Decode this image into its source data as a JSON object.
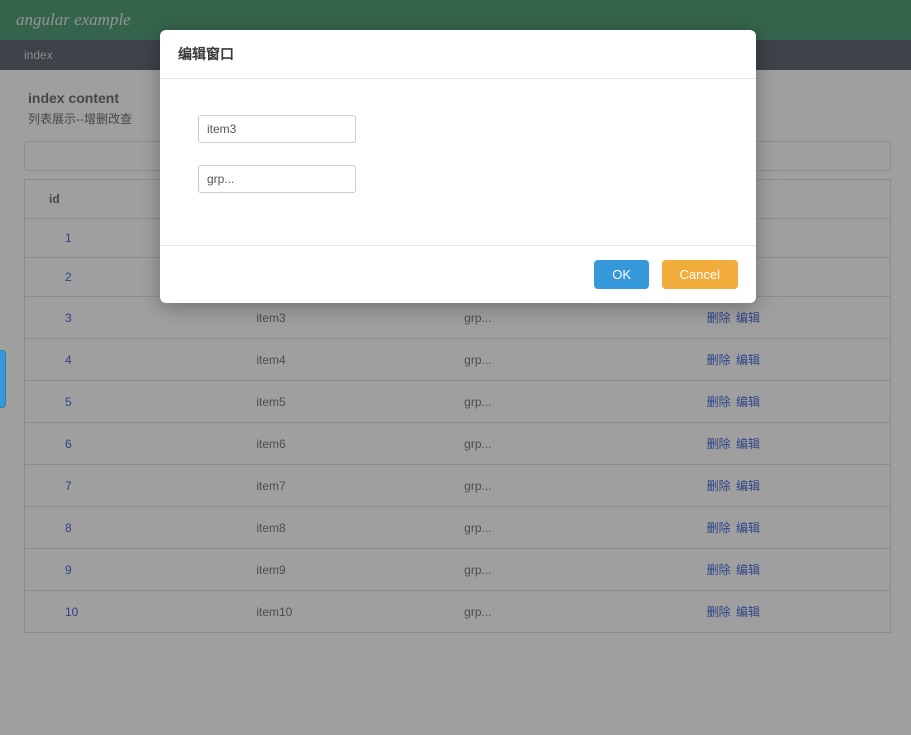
{
  "header": {
    "title": "angular example"
  },
  "tabs": [
    {
      "label": "index"
    }
  ],
  "page": {
    "title": "index content",
    "subtitle": "列表展示--增删改查"
  },
  "table": {
    "headers": {
      "id": "id",
      "name": "",
      "group": "",
      "actions": ""
    },
    "rows": [
      {
        "id": "1",
        "name": "",
        "group": "",
        "del": "",
        "edit": ""
      },
      {
        "id": "2",
        "name": "",
        "group": "",
        "del": "",
        "edit": ""
      },
      {
        "id": "3",
        "name": "item3",
        "group": "grp...",
        "del": "删除",
        "edit": "编辑"
      },
      {
        "id": "4",
        "name": "item4",
        "group": "grp...",
        "del": "删除",
        "edit": "编辑"
      },
      {
        "id": "5",
        "name": "item5",
        "group": "grp...",
        "del": "删除",
        "edit": "编辑"
      },
      {
        "id": "6",
        "name": "item6",
        "group": "grp...",
        "del": "删除",
        "edit": "编辑"
      },
      {
        "id": "7",
        "name": "item7",
        "group": "grp...",
        "del": "删除",
        "edit": "编辑"
      },
      {
        "id": "8",
        "name": "item8",
        "group": "grp...",
        "del": "删除",
        "edit": "编辑"
      },
      {
        "id": "9",
        "name": "item9",
        "group": "grp...",
        "del": "删除",
        "edit": "编辑"
      },
      {
        "id": "10",
        "name": "item10",
        "group": "grp...",
        "del": "删除",
        "edit": "编辑"
      }
    ]
  },
  "modal": {
    "title": "编辑窗口",
    "field1": "item3",
    "field2": "grp...",
    "ok": "OK",
    "cancel": "Cancel"
  }
}
